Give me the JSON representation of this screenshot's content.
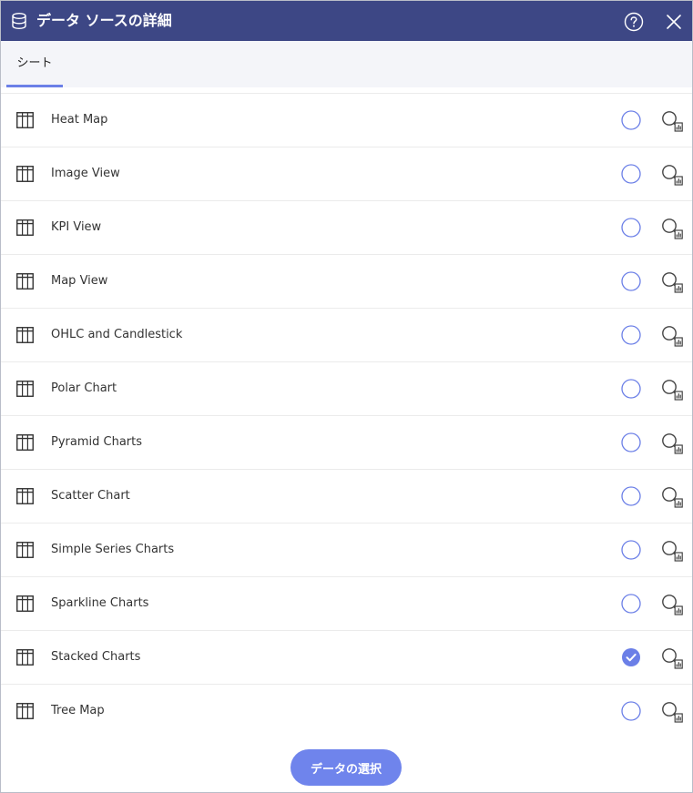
{
  "header": {
    "title": "データ ソースの詳細",
    "icons": {
      "datasource": "database-icon",
      "help": "help-icon",
      "close": "close-icon"
    },
    "color": "#3d4785"
  },
  "tabs": [
    {
      "label": "シート",
      "active": true
    }
  ],
  "accent_color": "#6b7fe7",
  "sheets": [
    {
      "label": "Heat Map",
      "selected": false
    },
    {
      "label": "Image View",
      "selected": false
    },
    {
      "label": "KPI View",
      "selected": false
    },
    {
      "label": "Map View",
      "selected": false
    },
    {
      "label": "OHLC and Candlestick",
      "selected": false
    },
    {
      "label": "Polar Chart",
      "selected": false
    },
    {
      "label": "Pyramid Charts",
      "selected": false
    },
    {
      "label": "Scatter Chart",
      "selected": false
    },
    {
      "label": "Simple Series Charts",
      "selected": false
    },
    {
      "label": "Sparkline Charts",
      "selected": false
    },
    {
      "label": "Stacked Charts",
      "selected": true
    },
    {
      "label": "Tree Map",
      "selected": false
    }
  ],
  "footer": {
    "select_label": "データの選択"
  }
}
